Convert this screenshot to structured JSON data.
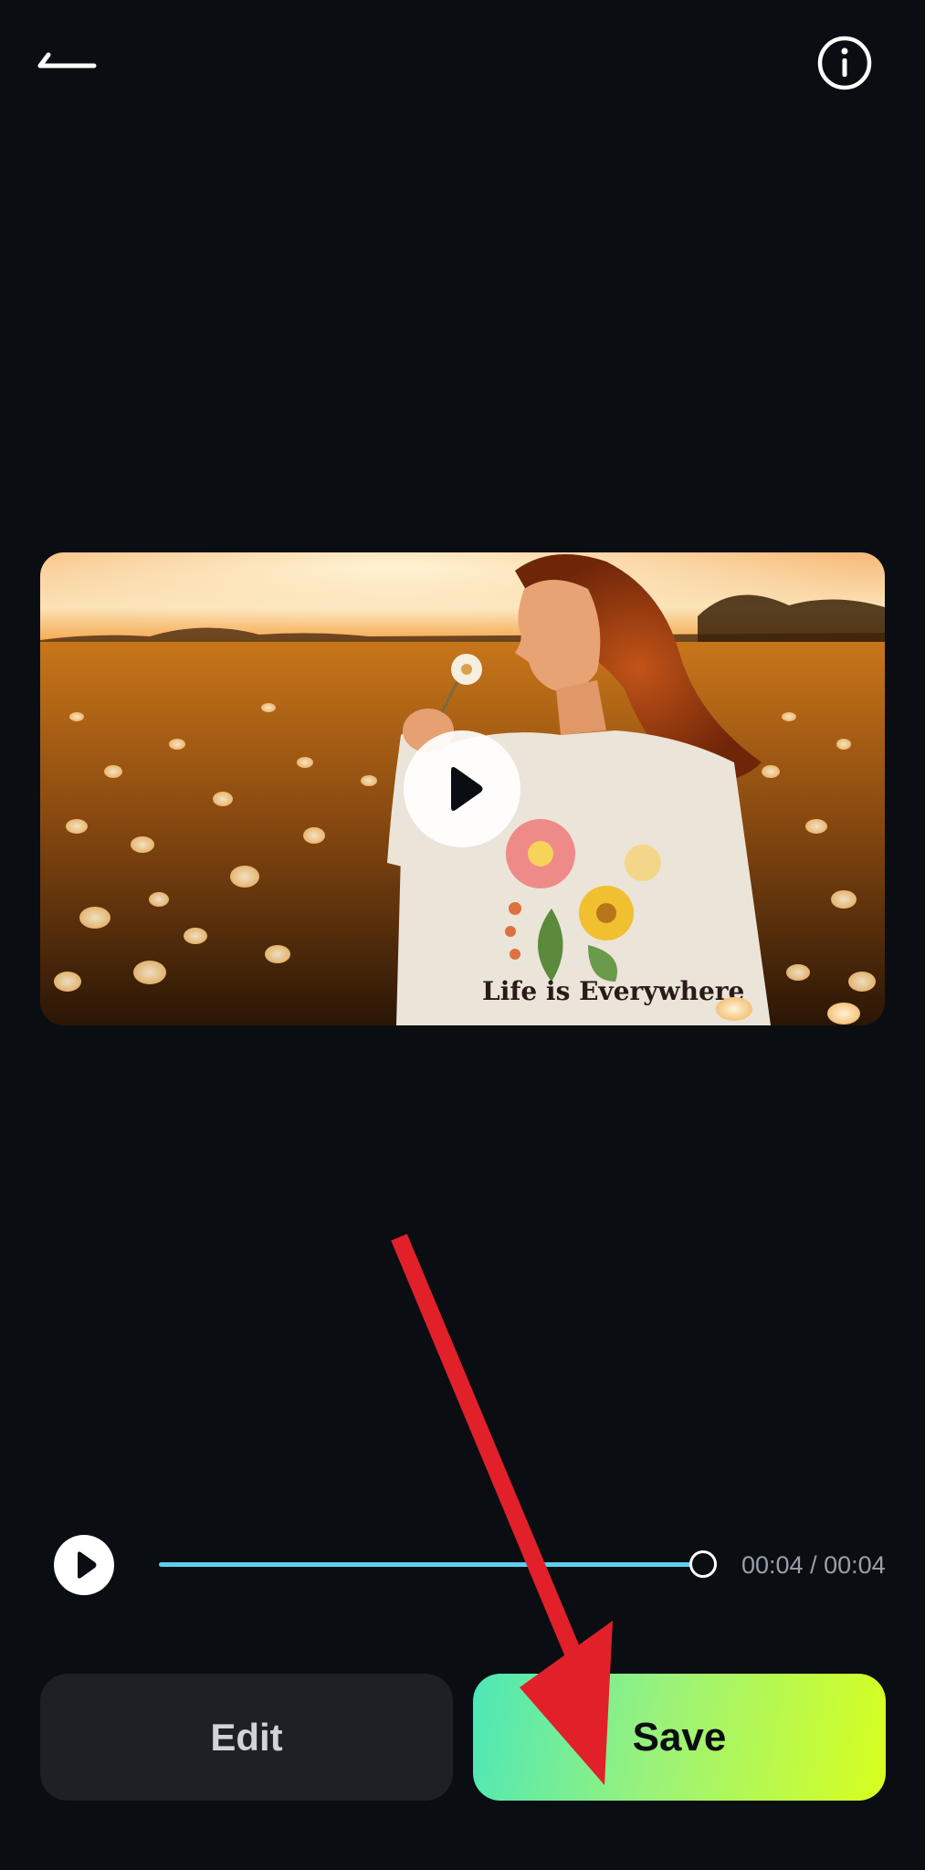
{
  "header": {
    "back_icon": "back-arrow-icon",
    "info_icon": "info-icon"
  },
  "preview": {
    "thumbnail": "woman-in-flower-field-at-sunset",
    "shirt_text": "Life is Everywhere",
    "play_icon": "play-icon"
  },
  "player": {
    "play_icon": "play-icon",
    "progress_fraction": 1.0,
    "time": "00:04 / 00:04"
  },
  "actions": {
    "edit_label": "Edit",
    "save_label": "Save"
  },
  "annotation": {
    "arrow_color": "#e2202a",
    "points_to": "save-button"
  },
  "colors": {
    "background": "#0a0e13",
    "accent_track": "#5ad1f0",
    "save_gradient_start": "#4ce7b8",
    "save_gradient_end": "#d8ff1e",
    "edit_bg": "#1d2126"
  }
}
